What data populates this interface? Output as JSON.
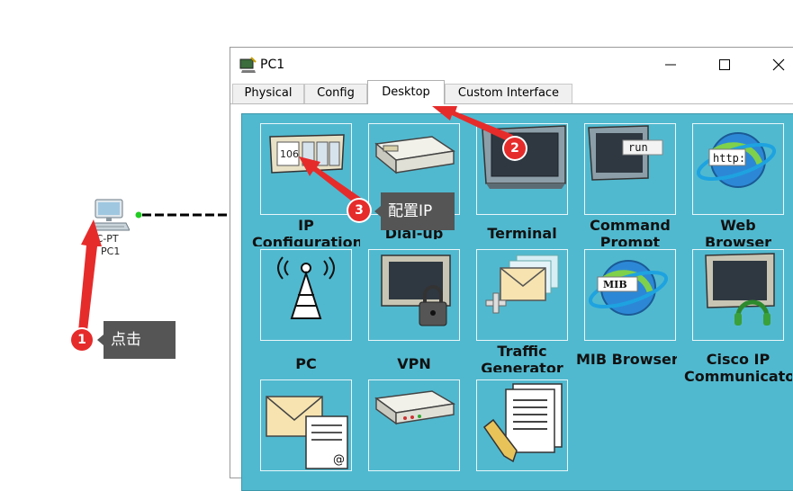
{
  "topology": {
    "pc_type_label": "PC-PT",
    "pc_name_label": "PC1",
    "link_color": "#000000",
    "port_color": "#22cc22"
  },
  "window": {
    "title": "PC1",
    "controls": [
      "minimize-icon",
      "maximize-icon",
      "close-icon"
    ]
  },
  "tabs": [
    {
      "label": "Physical",
      "active": false
    },
    {
      "label": "Config",
      "active": false
    },
    {
      "label": "Desktop",
      "active": true
    },
    {
      "label": "Custom Interface",
      "active": false
    }
  ],
  "desktop": {
    "background": "#51b9cf",
    "apps": [
      {
        "label": "IP Configuration",
        "line1": "IP",
        "line2": "Configuration",
        "icon": "ip-configuration-icon",
        "icon_text": "106"
      },
      {
        "label": "Dial-up",
        "line1": "Dial-up",
        "icon": "dial-up-modem-icon"
      },
      {
        "label": "Terminal",
        "line1": "Terminal",
        "icon": "terminal-monitor-icon"
      },
      {
        "label": "Command Prompt",
        "line1": "Command",
        "line2": "Prompt",
        "icon": "command-prompt-icon",
        "icon_text": "run"
      },
      {
        "label": "Web Browser",
        "line1": "Web",
        "line2": "Browser",
        "icon": "web-browser-icon",
        "icon_text": "http:"
      },
      {
        "label": "PC",
        "line1": "PC",
        "icon": "wireless-antenna-icon"
      },
      {
        "label": "VPN",
        "line1": "VPN",
        "icon": "vpn-lock-icon"
      },
      {
        "label": "Traffic Generator",
        "line1": "Traffic",
        "line2": "Generator",
        "icon": "traffic-generator-icon"
      },
      {
        "label": "MIB Browser",
        "line1": "MIB Browser",
        "icon": "mib-browser-icon",
        "icon_text": "MIB"
      },
      {
        "label": "Cisco IP Communicator",
        "line1": "Cisco IP",
        "line2": "Communicator",
        "icon": "ip-communicator-icon"
      },
      {
        "label": "Email",
        "icon": "email-icon",
        "icon_text": "@"
      },
      {
        "label": "PPPoE Dialer",
        "icon": "pppoe-modem-icon"
      },
      {
        "label": "Text Editor",
        "icon": "text-editor-icon"
      }
    ]
  },
  "annotations": {
    "step1": {
      "number": "1",
      "text": "点击"
    },
    "step2": {
      "number": "2"
    },
    "step3": {
      "number": "3",
      "text": "配置IP"
    },
    "arrow_color": "#e62b2b"
  }
}
